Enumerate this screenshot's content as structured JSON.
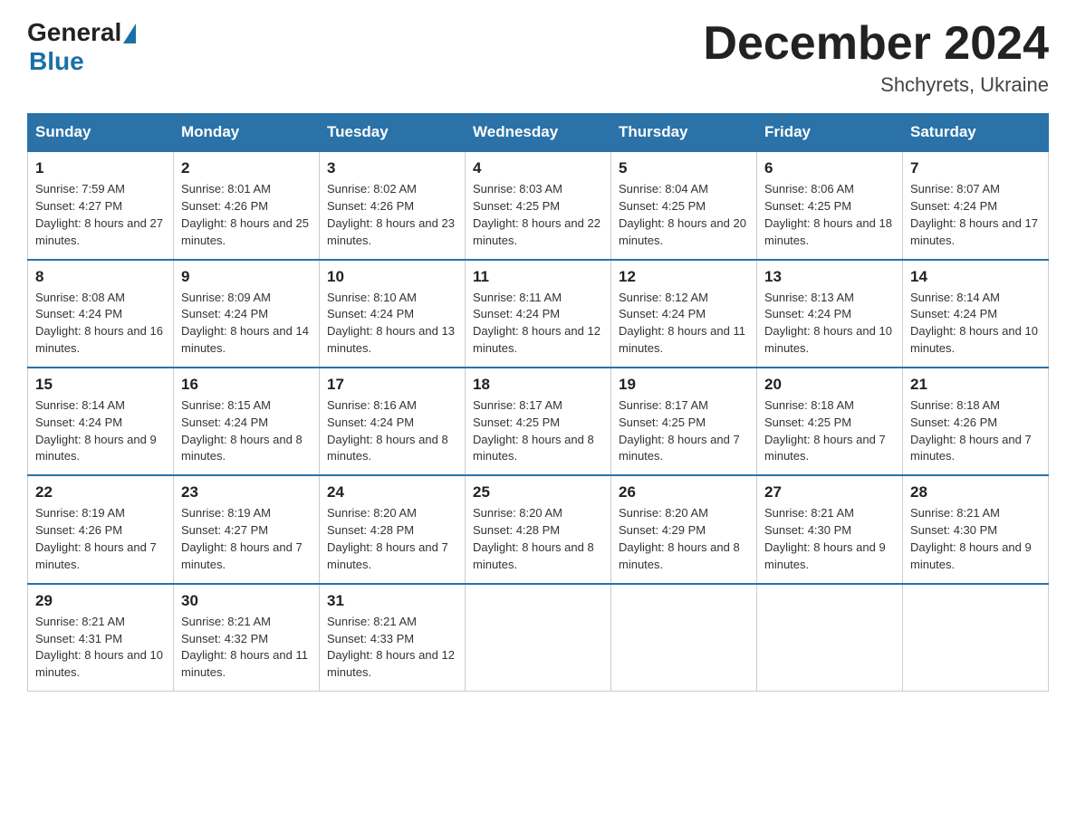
{
  "header": {
    "logo_general": "General",
    "logo_blue": "Blue",
    "month_title": "December 2024",
    "location": "Shchyrets, Ukraine"
  },
  "weekdays": [
    "Sunday",
    "Monday",
    "Tuesday",
    "Wednesday",
    "Thursday",
    "Friday",
    "Saturday"
  ],
  "weeks": [
    [
      {
        "day": "1",
        "sunrise": "Sunrise: 7:59 AM",
        "sunset": "Sunset: 4:27 PM",
        "daylight": "Daylight: 8 hours and 27 minutes."
      },
      {
        "day": "2",
        "sunrise": "Sunrise: 8:01 AM",
        "sunset": "Sunset: 4:26 PM",
        "daylight": "Daylight: 8 hours and 25 minutes."
      },
      {
        "day": "3",
        "sunrise": "Sunrise: 8:02 AM",
        "sunset": "Sunset: 4:26 PM",
        "daylight": "Daylight: 8 hours and 23 minutes."
      },
      {
        "day": "4",
        "sunrise": "Sunrise: 8:03 AM",
        "sunset": "Sunset: 4:25 PM",
        "daylight": "Daylight: 8 hours and 22 minutes."
      },
      {
        "day": "5",
        "sunrise": "Sunrise: 8:04 AM",
        "sunset": "Sunset: 4:25 PM",
        "daylight": "Daylight: 8 hours and 20 minutes."
      },
      {
        "day": "6",
        "sunrise": "Sunrise: 8:06 AM",
        "sunset": "Sunset: 4:25 PM",
        "daylight": "Daylight: 8 hours and 18 minutes."
      },
      {
        "day": "7",
        "sunrise": "Sunrise: 8:07 AM",
        "sunset": "Sunset: 4:24 PM",
        "daylight": "Daylight: 8 hours and 17 minutes."
      }
    ],
    [
      {
        "day": "8",
        "sunrise": "Sunrise: 8:08 AM",
        "sunset": "Sunset: 4:24 PM",
        "daylight": "Daylight: 8 hours and 16 minutes."
      },
      {
        "day": "9",
        "sunrise": "Sunrise: 8:09 AM",
        "sunset": "Sunset: 4:24 PM",
        "daylight": "Daylight: 8 hours and 14 minutes."
      },
      {
        "day": "10",
        "sunrise": "Sunrise: 8:10 AM",
        "sunset": "Sunset: 4:24 PM",
        "daylight": "Daylight: 8 hours and 13 minutes."
      },
      {
        "day": "11",
        "sunrise": "Sunrise: 8:11 AM",
        "sunset": "Sunset: 4:24 PM",
        "daylight": "Daylight: 8 hours and 12 minutes."
      },
      {
        "day": "12",
        "sunrise": "Sunrise: 8:12 AM",
        "sunset": "Sunset: 4:24 PM",
        "daylight": "Daylight: 8 hours and 11 minutes."
      },
      {
        "day": "13",
        "sunrise": "Sunrise: 8:13 AM",
        "sunset": "Sunset: 4:24 PM",
        "daylight": "Daylight: 8 hours and 10 minutes."
      },
      {
        "day": "14",
        "sunrise": "Sunrise: 8:14 AM",
        "sunset": "Sunset: 4:24 PM",
        "daylight": "Daylight: 8 hours and 10 minutes."
      }
    ],
    [
      {
        "day": "15",
        "sunrise": "Sunrise: 8:14 AM",
        "sunset": "Sunset: 4:24 PM",
        "daylight": "Daylight: 8 hours and 9 minutes."
      },
      {
        "day": "16",
        "sunrise": "Sunrise: 8:15 AM",
        "sunset": "Sunset: 4:24 PM",
        "daylight": "Daylight: 8 hours and 8 minutes."
      },
      {
        "day": "17",
        "sunrise": "Sunrise: 8:16 AM",
        "sunset": "Sunset: 4:24 PM",
        "daylight": "Daylight: 8 hours and 8 minutes."
      },
      {
        "day": "18",
        "sunrise": "Sunrise: 8:17 AM",
        "sunset": "Sunset: 4:25 PM",
        "daylight": "Daylight: 8 hours and 8 minutes."
      },
      {
        "day": "19",
        "sunrise": "Sunrise: 8:17 AM",
        "sunset": "Sunset: 4:25 PM",
        "daylight": "Daylight: 8 hours and 7 minutes."
      },
      {
        "day": "20",
        "sunrise": "Sunrise: 8:18 AM",
        "sunset": "Sunset: 4:25 PM",
        "daylight": "Daylight: 8 hours and 7 minutes."
      },
      {
        "day": "21",
        "sunrise": "Sunrise: 8:18 AM",
        "sunset": "Sunset: 4:26 PM",
        "daylight": "Daylight: 8 hours and 7 minutes."
      }
    ],
    [
      {
        "day": "22",
        "sunrise": "Sunrise: 8:19 AM",
        "sunset": "Sunset: 4:26 PM",
        "daylight": "Daylight: 8 hours and 7 minutes."
      },
      {
        "day": "23",
        "sunrise": "Sunrise: 8:19 AM",
        "sunset": "Sunset: 4:27 PM",
        "daylight": "Daylight: 8 hours and 7 minutes."
      },
      {
        "day": "24",
        "sunrise": "Sunrise: 8:20 AM",
        "sunset": "Sunset: 4:28 PM",
        "daylight": "Daylight: 8 hours and 7 minutes."
      },
      {
        "day": "25",
        "sunrise": "Sunrise: 8:20 AM",
        "sunset": "Sunset: 4:28 PM",
        "daylight": "Daylight: 8 hours and 8 minutes."
      },
      {
        "day": "26",
        "sunrise": "Sunrise: 8:20 AM",
        "sunset": "Sunset: 4:29 PM",
        "daylight": "Daylight: 8 hours and 8 minutes."
      },
      {
        "day": "27",
        "sunrise": "Sunrise: 8:21 AM",
        "sunset": "Sunset: 4:30 PM",
        "daylight": "Daylight: 8 hours and 9 minutes."
      },
      {
        "day": "28",
        "sunrise": "Sunrise: 8:21 AM",
        "sunset": "Sunset: 4:30 PM",
        "daylight": "Daylight: 8 hours and 9 minutes."
      }
    ],
    [
      {
        "day": "29",
        "sunrise": "Sunrise: 8:21 AM",
        "sunset": "Sunset: 4:31 PM",
        "daylight": "Daylight: 8 hours and 10 minutes."
      },
      {
        "day": "30",
        "sunrise": "Sunrise: 8:21 AM",
        "sunset": "Sunset: 4:32 PM",
        "daylight": "Daylight: 8 hours and 11 minutes."
      },
      {
        "day": "31",
        "sunrise": "Sunrise: 8:21 AM",
        "sunset": "Sunset: 4:33 PM",
        "daylight": "Daylight: 8 hours and 12 minutes."
      },
      null,
      null,
      null,
      null
    ]
  ]
}
